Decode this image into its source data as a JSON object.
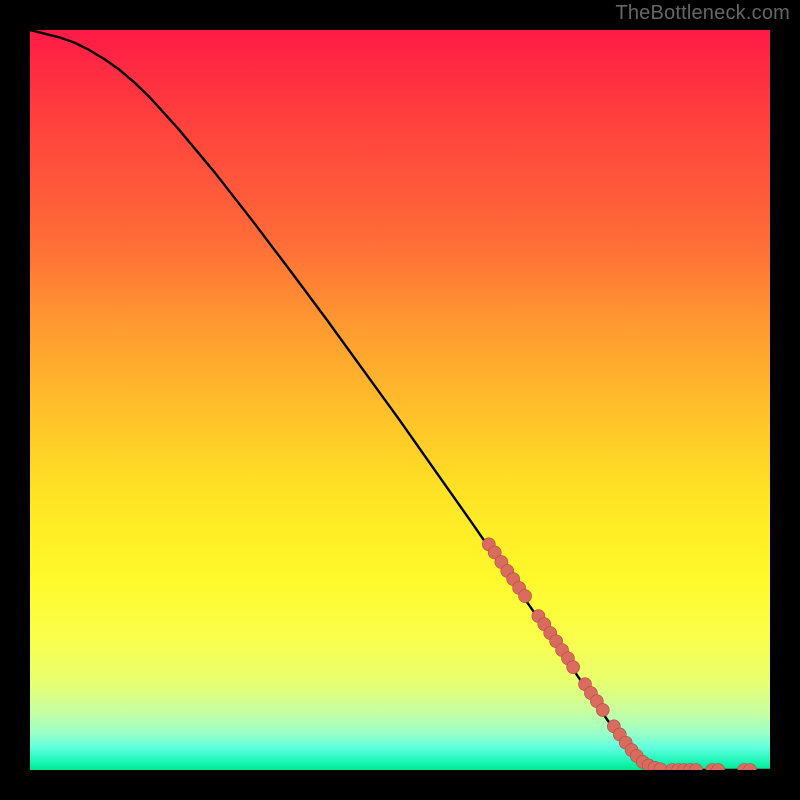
{
  "watermark": "TheBottleneck.com",
  "colors": {
    "page_bg": "#000000",
    "curve": "#000000",
    "marker_fill": "#d96b5f",
    "marker_stroke": "#b04a42",
    "gradient_top": "#ff1a46",
    "gradient_bottom": "#00e88f"
  },
  "chart_data": {
    "type": "line",
    "title": "",
    "xlabel": "",
    "ylabel": "",
    "xlim": [
      0,
      100
    ],
    "ylim": [
      0,
      100
    ],
    "legend": false,
    "grid": false,
    "curve_comment": "Smooth descending curve from top-left to bottom-right; values estimated from pixel positions on a 0-100 axis.",
    "series": [
      {
        "name": "curve",
        "x": [
          0,
          2,
          4,
          6,
          8,
          10,
          12,
          14,
          16,
          20,
          25,
          30,
          35,
          40,
          45,
          50,
          55,
          60,
          62,
          65,
          70,
          72,
          74,
          76,
          78,
          80,
          82,
          85,
          88,
          92,
          96,
          100
        ],
        "y": [
          100,
          99.5,
          99,
          98.3,
          97.3,
          96.1,
          94.7,
          93.0,
          91.1,
          86.7,
          80.7,
          74.3,
          67.7,
          61.0,
          54.1,
          47.2,
          40.1,
          33.0,
          30.1,
          25.8,
          18.6,
          15.7,
          12.7,
          9.8,
          6.8,
          4.0,
          1.8,
          0.4,
          0.0,
          0.0,
          0.0,
          0.0
        ]
      }
    ],
    "markers_comment": "Clusters of salmon-colored round markers along the lower-right portion of the curve and along the baseline.",
    "markers": [
      {
        "x": 62.0,
        "y": 30.5
      },
      {
        "x": 62.8,
        "y": 29.4
      },
      {
        "x": 63.7,
        "y": 28.1
      },
      {
        "x": 64.5,
        "y": 26.9
      },
      {
        "x": 65.3,
        "y": 25.8
      },
      {
        "x": 66.1,
        "y": 24.6
      },
      {
        "x": 66.9,
        "y": 23.5
      },
      {
        "x": 68.7,
        "y": 20.8
      },
      {
        "x": 69.5,
        "y": 19.7
      },
      {
        "x": 70.3,
        "y": 18.5
      },
      {
        "x": 71.1,
        "y": 17.4
      },
      {
        "x": 71.9,
        "y": 16.2
      },
      {
        "x": 72.7,
        "y": 15.1
      },
      {
        "x": 73.4,
        "y": 13.9
      },
      {
        "x": 75.0,
        "y": 11.6
      },
      {
        "x": 75.8,
        "y": 10.4
      },
      {
        "x": 76.6,
        "y": 9.3
      },
      {
        "x": 77.4,
        "y": 8.1
      },
      {
        "x": 78.9,
        "y": 5.9
      },
      {
        "x": 79.7,
        "y": 4.8
      },
      {
        "x": 80.5,
        "y": 3.7
      },
      {
        "x": 81.3,
        "y": 2.7
      },
      {
        "x": 82.0,
        "y": 1.9
      },
      {
        "x": 82.8,
        "y": 1.1
      },
      {
        "x": 83.6,
        "y": 0.6
      },
      {
        "x": 84.4,
        "y": 0.3
      },
      {
        "x": 85.2,
        "y": 0.1
      },
      {
        "x": 86.8,
        "y": 0.0
      },
      {
        "x": 87.6,
        "y": 0.0
      },
      {
        "x": 88.4,
        "y": 0.0
      },
      {
        "x": 89.2,
        "y": 0.0
      },
      {
        "x": 90.0,
        "y": 0.0
      },
      {
        "x": 92.2,
        "y": 0.0
      },
      {
        "x": 93.0,
        "y": 0.0
      },
      {
        "x": 96.5,
        "y": 0.0
      },
      {
        "x": 97.3,
        "y": 0.0
      }
    ]
  }
}
